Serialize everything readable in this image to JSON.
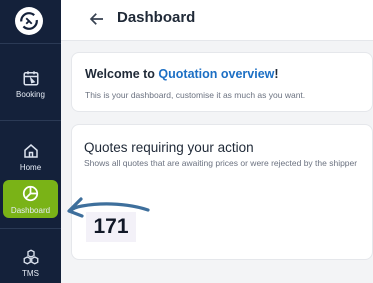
{
  "sidebar": {
    "logo_icon": "sync-logo-icon",
    "items": [
      {
        "label": "Booking",
        "icon": "calendar-icon"
      },
      {
        "label": "Home",
        "icon": "home-icon"
      },
      {
        "label": "Dashboard",
        "icon": "pie-chart-icon",
        "active": true
      },
      {
        "label": "TMS",
        "icon": "boxes-icon"
      }
    ],
    "active_color": "#7ab317",
    "background": "#14213a"
  },
  "header": {
    "back_icon": "arrow-left-icon",
    "title": "Dashboard"
  },
  "welcome_card": {
    "heading_prefix": "Welcome to ",
    "heading_accent": "Quotation overview",
    "heading_suffix": "!",
    "subtitle": "This is your dashboard, customise it as much as you want.",
    "accent_color": "#1c6fc4"
  },
  "quotes_card": {
    "heading": "Quotes requiring your action",
    "description": "Shows all quotes that are awaiting prices or were rejected by the shipper",
    "count": "171"
  },
  "annotation": {
    "icon": "curved-arrow-annotation",
    "color": "#3e6f9c"
  }
}
